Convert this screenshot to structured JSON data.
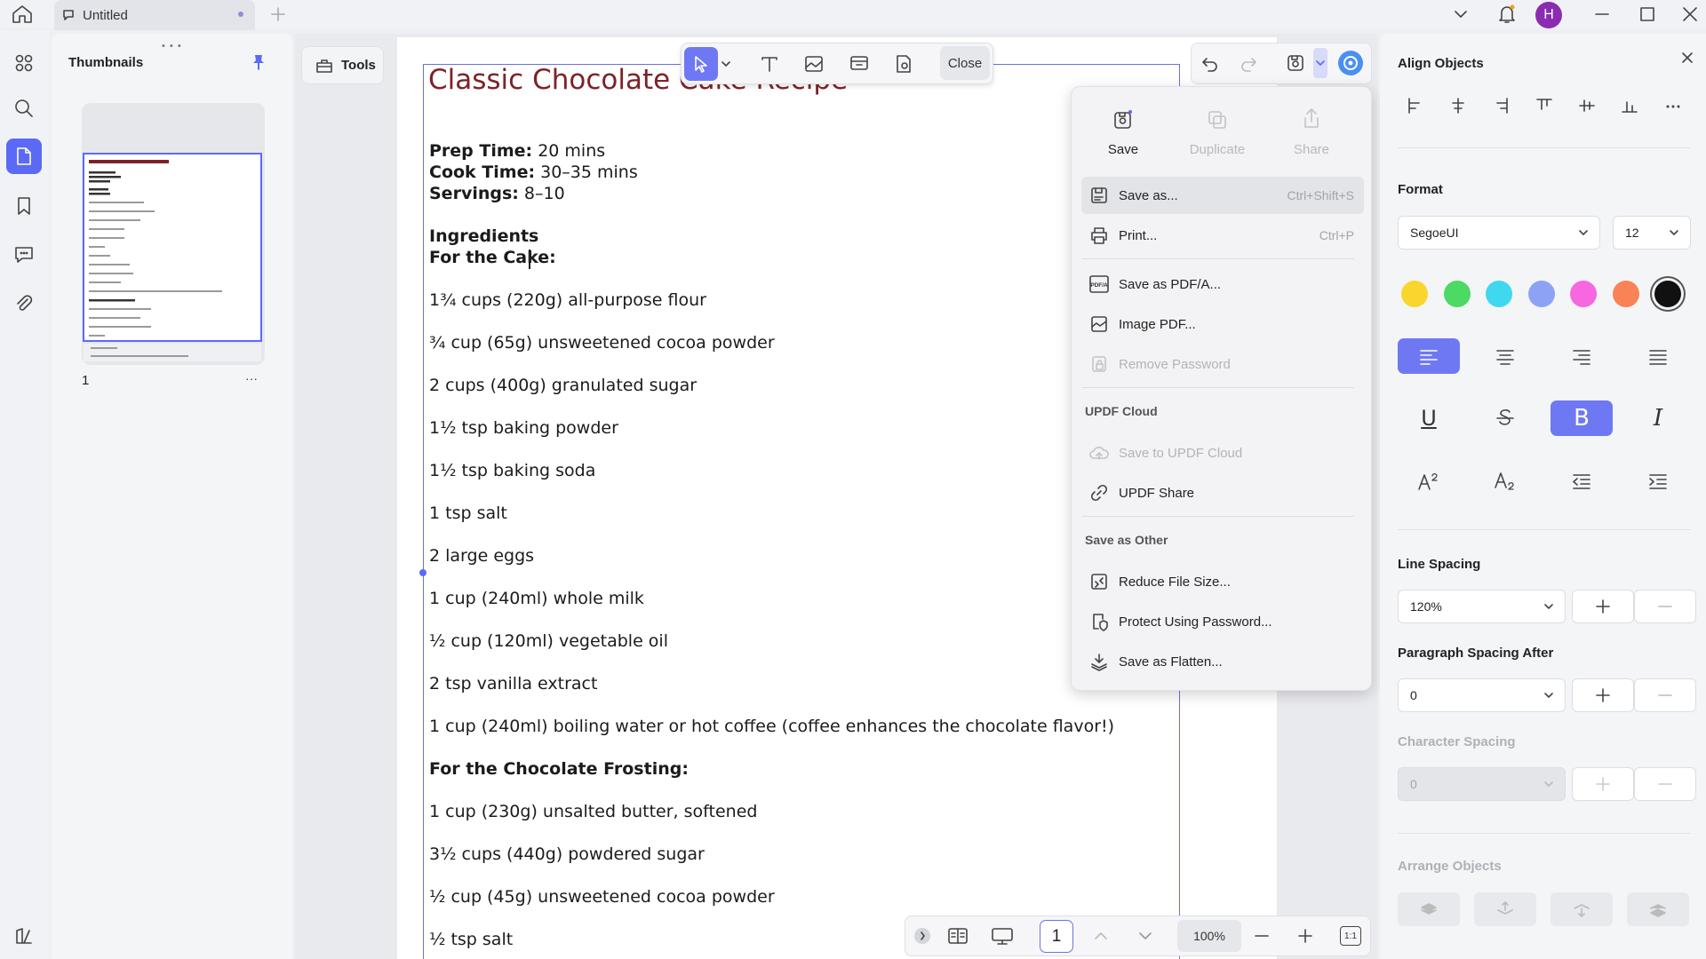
{
  "app": {
    "tab_title": "Untitled",
    "avatar_letter": "H",
    "accent_color": "#5b6af5"
  },
  "thumbnails": {
    "title": "Thumbnails",
    "page_label": "1",
    "more": "···"
  },
  "tools_label": "Tools",
  "edit_toolbar": {
    "close_label": "Close"
  },
  "document": {
    "title": "Classic Chocolate Cake Recipe",
    "prep_label": "Prep Time:",
    "prep_value": " 20 mins",
    "cook_label": "Cook Time:",
    "cook_value": " 30–35 mins",
    "serv_label": "Servings:",
    "serv_value": " 8–10",
    "ingredients_heading": "Ingredients",
    "cake_heading": "For the Cake:",
    "cake_items": [
      "1¾ cups (220g) all-purpose flour",
      "¾ cup (65g) unsweetened cocoa powder",
      "2 cups (400g) granulated sugar",
      "1½ tsp baking powder",
      "1½ tsp baking soda",
      "1 tsp salt",
      "2 large eggs",
      "1 cup (240ml) whole milk",
      "½ cup (120ml) vegetable oil",
      "2 tsp vanilla extract",
      "1 cup (240ml) boiling water or hot coffee (coffee enhances the chocolate flavor!)"
    ],
    "frosting_heading": "For the Chocolate Frosting:",
    "frosting_items": [
      "1 cup (230g) unsalted butter, softened",
      "3½ cups (440g) powdered sugar",
      "½ cup (45g) unsweetened cocoa powder",
      "½ tsp salt"
    ]
  },
  "save_menu": {
    "top": {
      "save": "Save",
      "duplicate": "Duplicate",
      "share": "Share"
    },
    "save_as": "Save as...",
    "save_as_shortcut": "Ctrl+Shift+S",
    "print": "Print...",
    "print_shortcut": "Ctrl+P",
    "save_pdfa": "Save as PDF/A...",
    "image_pdf": "Image PDF...",
    "remove_password": "Remove Password",
    "cloud_heading": "UPDF Cloud",
    "save_cloud": "Save to UPDF Cloud",
    "updf_share": "UPDF Share",
    "other_heading": "Save as Other",
    "reduce": "Reduce File Size...",
    "protect": "Protect Using Password...",
    "flatten": "Save as Flatten...",
    "pdfa_icon_text": "PDF/A"
  },
  "right_panel": {
    "align_title": "Align Objects",
    "format_title": "Format",
    "font_value": "SegoeUI",
    "size_value": "12",
    "colors": [
      "#f9d62e",
      "#4cd964",
      "#3fd8ef",
      "#8ea2f5",
      "#f767e0",
      "#f98356",
      "#111111"
    ],
    "line_spacing_title": "Line Spacing",
    "line_spacing_value": "120%",
    "para_spacing_title": "Paragraph Spacing After",
    "para_spacing_value": "0",
    "char_spacing_title": "Character Spacing",
    "char_spacing_value": "0",
    "arrange_title": "Arrange Objects",
    "underline": "U",
    "bold": "B",
    "italic": "I"
  },
  "bottom_bar": {
    "page": "1",
    "zoom": "100%",
    "fit_label": "1:1"
  }
}
